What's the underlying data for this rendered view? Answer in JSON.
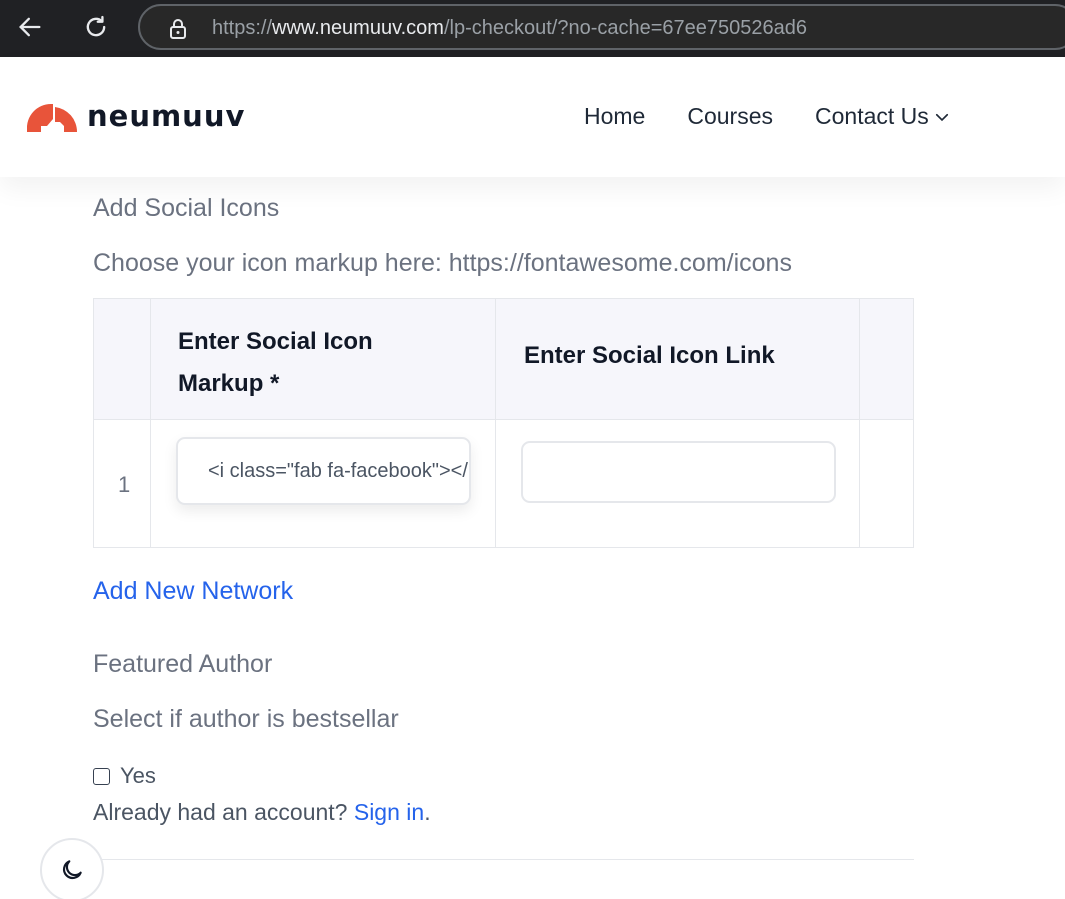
{
  "browser": {
    "url_prefix": "https://",
    "url_host": "www.neumuuv.com",
    "url_path": "/lp-checkout/?no-cache=67ee750526ad6"
  },
  "header": {
    "logo_text": "neumuuv",
    "nav": [
      {
        "label": "Home"
      },
      {
        "label": "Courses"
      },
      {
        "label": "Contact Us"
      }
    ]
  },
  "form": {
    "section_title": "Add Social Icons",
    "helper_text": "Choose your icon markup here: https://fontawesome.com/icons",
    "columns": {
      "markup": "Enter Social Icon Markup *",
      "link": "Enter Social Icon Link"
    },
    "rows": [
      {
        "index": "1",
        "markup_value": "<i class=\"fab fa-facebook\"></i>",
        "link_value": ""
      }
    ],
    "add_network_label": "Add New Network",
    "featured_title": "Featured Author",
    "featured_helper": "Select if author is bestsellar",
    "checkbox_label": "Yes",
    "account_prefix": "Already had an account? ",
    "sign_in_label": "Sign in",
    "account_suffix": "."
  },
  "colors": {
    "brand": "#e8543a",
    "link": "#2563eb"
  },
  "icons": {
    "back": "arrow-left-icon",
    "reload": "reload-icon",
    "lock": "lock-icon",
    "chevron": "chevron-down-icon",
    "theme": "moon-icon"
  }
}
